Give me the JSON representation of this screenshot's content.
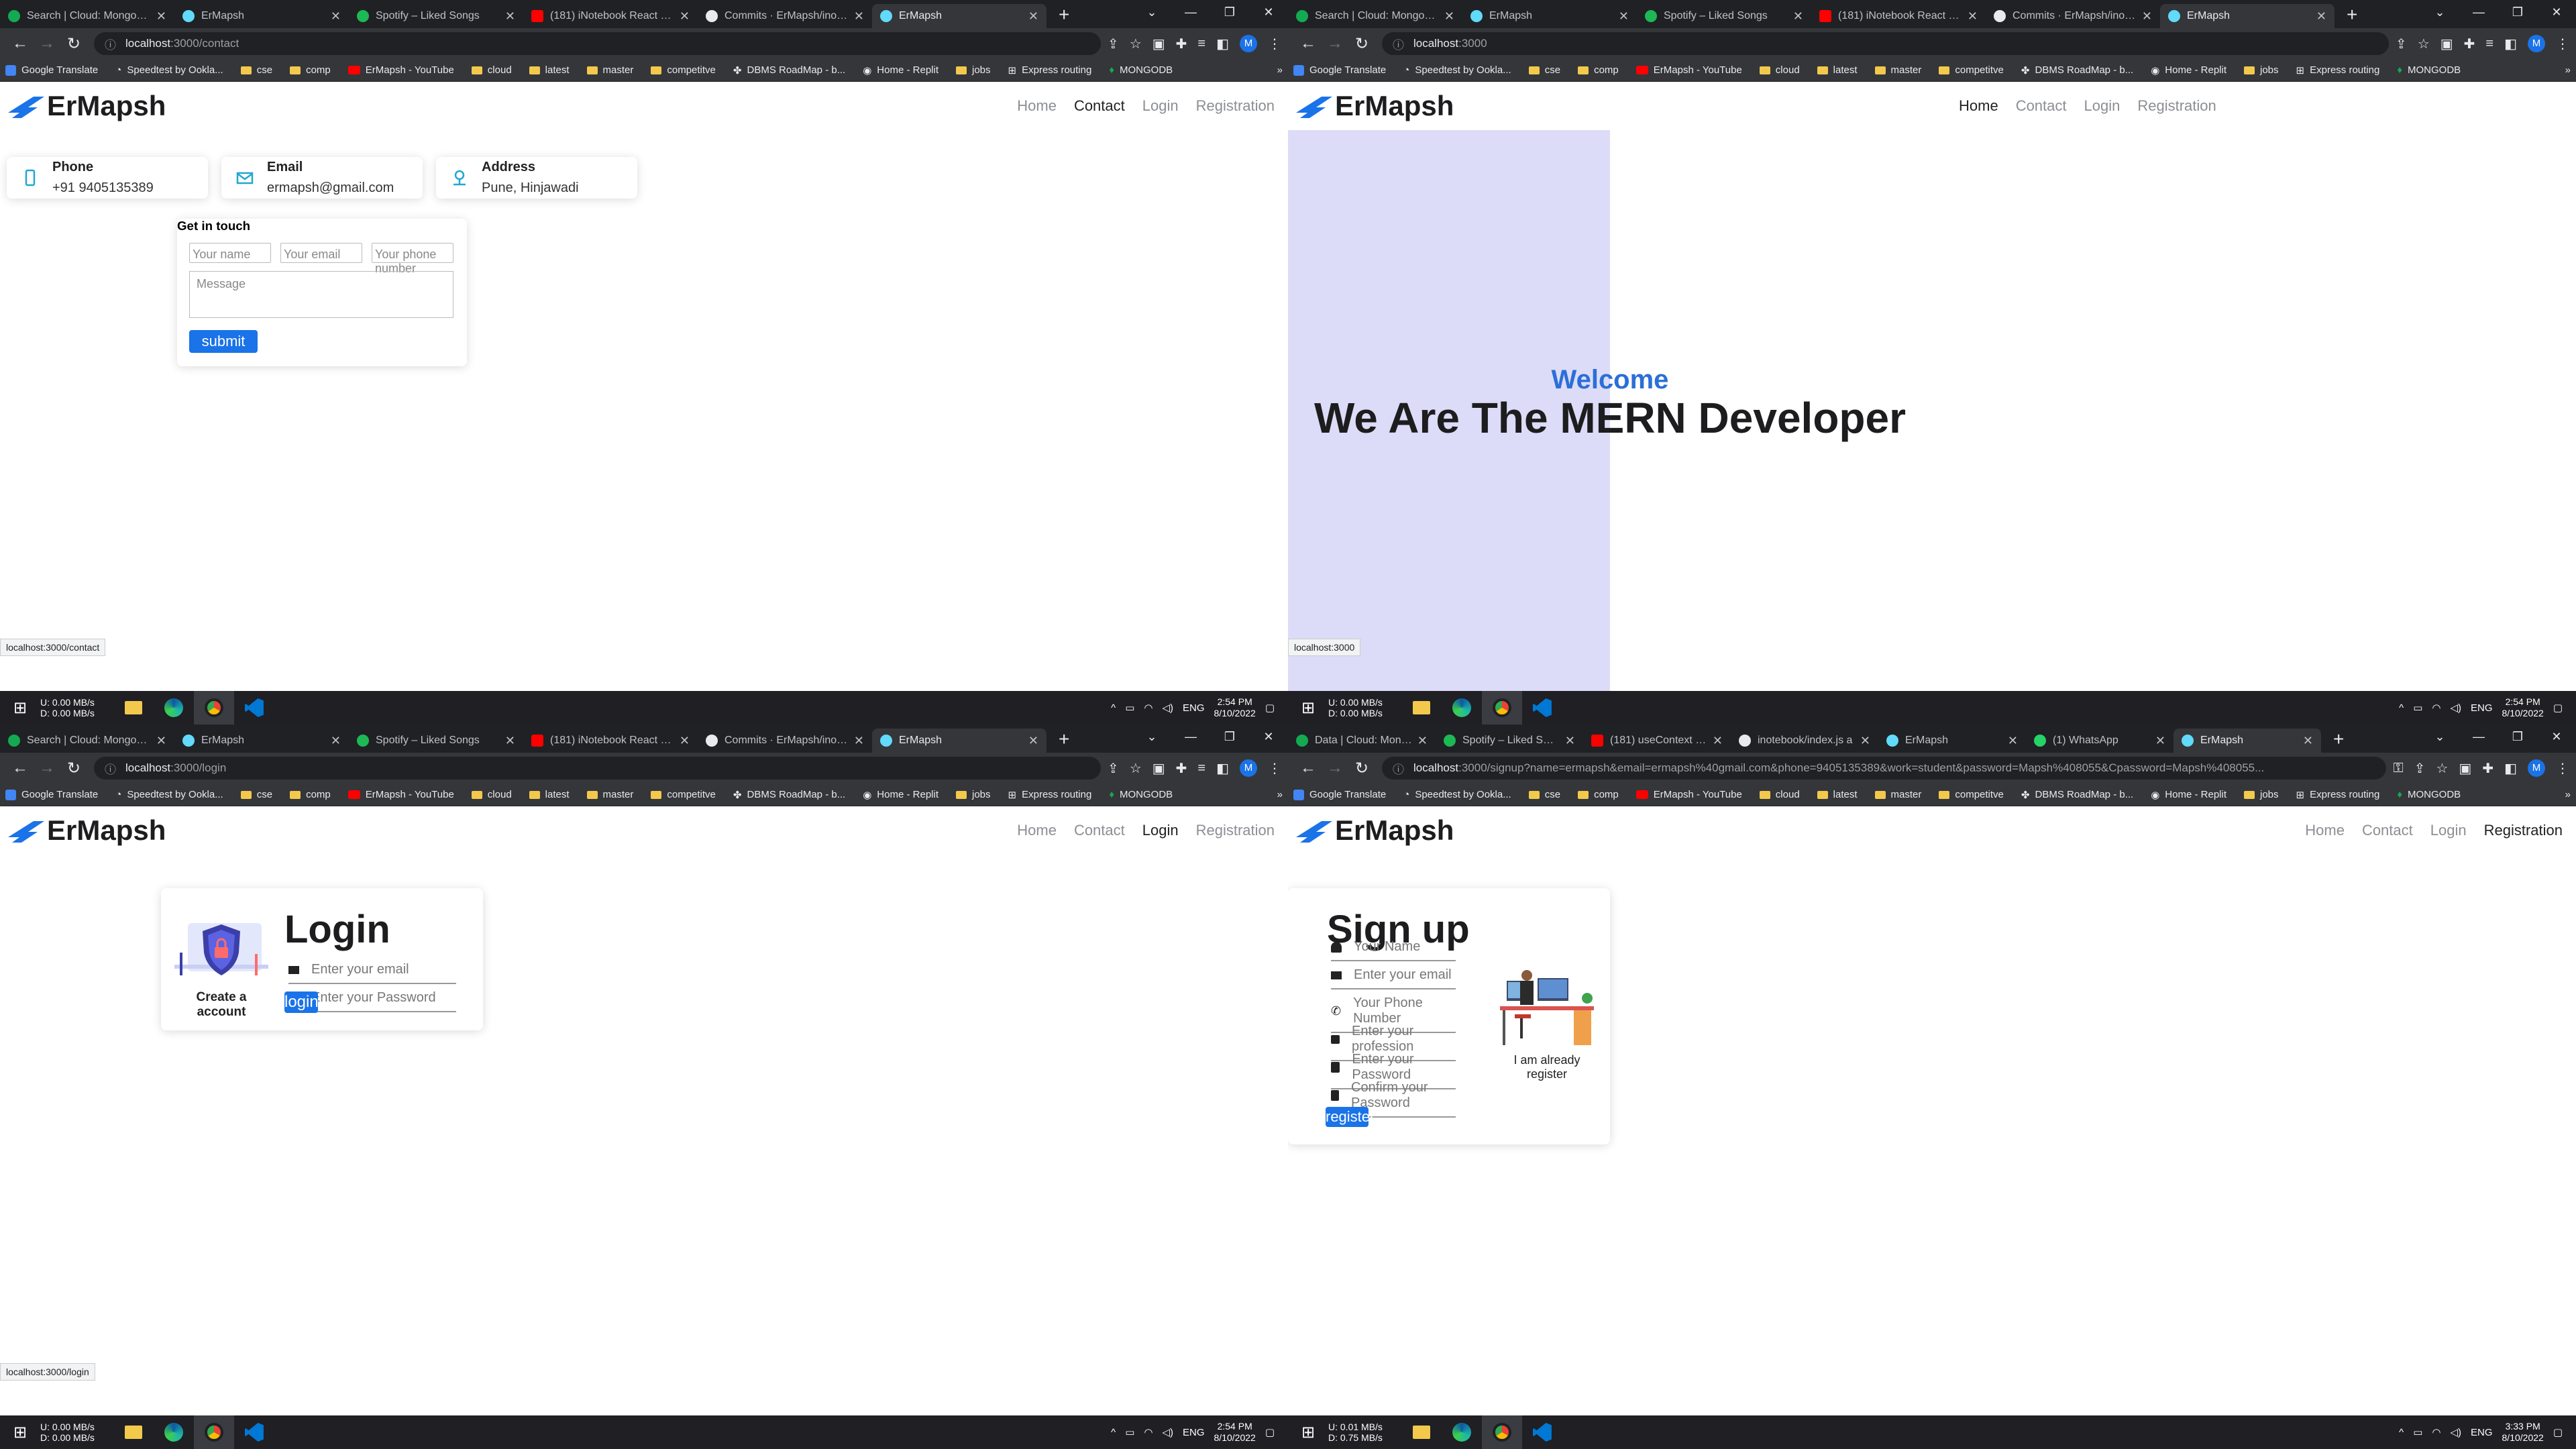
{
  "browser": {
    "q1_tabs": [
      "Search | Cloud: MongoDB C",
      "ErMapsh",
      "Spotify – Liked Songs",
      "(181) iNotebook React Proj",
      "Commits · ErMapsh/inotebo",
      "ErMapsh"
    ],
    "q3_tabs": [
      "Search | Cloud: MongoDB C",
      "ErMapsh",
      "Spotify – Liked Songs",
      "(181) iNotebook React Proj",
      "Commits · ErMapsh/inotebo",
      "ErMapsh"
    ],
    "q4_tabs": [
      "Data | Cloud: Mongo",
      "Spotify – Liked Songs",
      "(181) useContext ho",
      "inotebook/index.js a",
      "ErMapsh",
      "(1) WhatsApp",
      "ErMapsh"
    ],
    "url_contact_host": "localhost",
    "url_contact_path": ":3000/contact",
    "url_home_host": "localhost",
    "url_home_path": ":3000",
    "url_login_host": "localhost",
    "url_login_path": ":3000/login",
    "url_signup_host": "localhost",
    "url_signup_path": ":3000/signup?name=ermapsh&email=ermapsh%40gmail.com&phone=9405135389&work=student&password=Mapsh%408055&Cpassword=Mapsh%408055...",
    "profile_initial": "M",
    "bookmarks": [
      "Google Translate",
      "Speedtest by Ookla...",
      "cse",
      "comp",
      "ErMapsh - YouTube",
      "cloud",
      "latest",
      "master",
      "competitve",
      "DBMS RoadMap - b...",
      "Home - Replit",
      "jobs",
      "Express routing",
      "MONGODB"
    ],
    "more": "»"
  },
  "site": {
    "brand": "ErMapsh",
    "nav": {
      "home": "Home",
      "contact": "Contact",
      "login": "Login",
      "registration": "Registration"
    }
  },
  "contact": {
    "phone_title": "Phone",
    "phone_value": "+91 9405135389",
    "email_title": "Email",
    "email_value": "ermapsh@gmail.com",
    "address_title": "Address",
    "address_value": "Pune, Hinjawadi",
    "form_title": "Get in touch",
    "name_ph": "Your name",
    "email_ph": "Your email",
    "phone_ph": "Your phone number",
    "message_ph": "Message",
    "submit": "submit",
    "status": "localhost:3000/contact"
  },
  "home": {
    "welcome": "Welcome",
    "headline": "We Are The MERN Developer",
    "status": "localhost:3000"
  },
  "login": {
    "title": "Login",
    "email_ph": "Enter your email",
    "password_ph": "Enter your Password",
    "create_account": "Create a account",
    "button": "login",
    "status": "localhost:3000/login"
  },
  "signup": {
    "title": "Sign up",
    "name_ph": "Your Name",
    "email_ph": "Enter your email",
    "phone_ph": "Your Phone Number",
    "profession_ph": "Enter your profession",
    "password_ph": "Enter your Password",
    "confirm_ph": "Confirm your Password",
    "already": "I am already register",
    "button": "register"
  },
  "taskbar": {
    "up_label": "U:",
    "down_label": "D:",
    "q1_up": "0.00 MB/s",
    "q1_down": "0.00 MB/s",
    "q4_up": "0.01 MB/s",
    "q4_down": "0.75 MB/s",
    "lang": "ENG",
    "time_a": "2:54 PM",
    "time_b": "3:33 PM",
    "date": "8/10/2022"
  }
}
